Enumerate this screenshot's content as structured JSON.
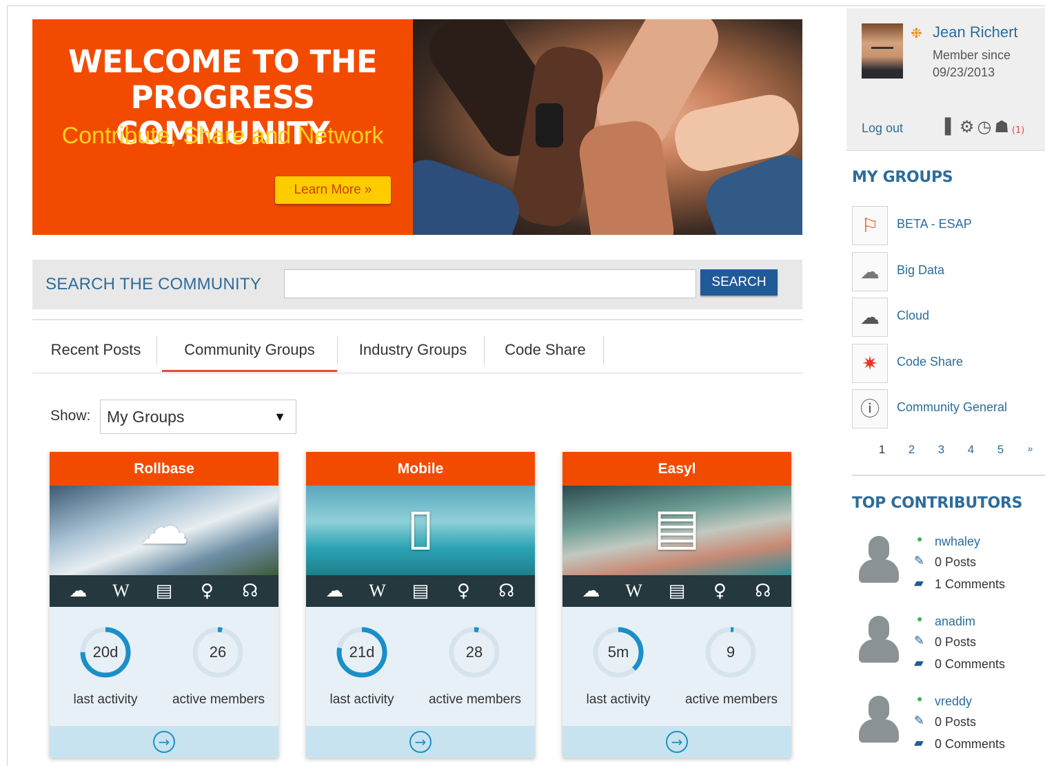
{
  "banner": {
    "title_line1": "WELCOME TO THE",
    "title_line2": "PROGRESS COMMUNITY",
    "subtitle": "Contribute, Share and Network",
    "learn_more": "Learn More »"
  },
  "search": {
    "label": "SEARCH THE COMMUNITY",
    "value": "",
    "button": "SEARCH"
  },
  "tabs": [
    {
      "label": "Recent Posts",
      "active": false
    },
    {
      "label": "Community Groups",
      "active": true
    },
    {
      "label": "Industry Groups",
      "active": false
    },
    {
      "label": "Code Share",
      "active": false
    }
  ],
  "filter": {
    "label": "Show:",
    "selected": "My Groups",
    "arrow": "▼"
  },
  "cards": [
    {
      "title": "Rollbase",
      "icon": "cloud-table-icon",
      "last_activity": "20d",
      "last_activity_label": "last activity",
      "active_members": "26",
      "active_members_label": "active members",
      "activity_fill": 0.75,
      "members_fill": 0.03
    },
    {
      "title": "Mobile",
      "icon": "smartphone-icon",
      "last_activity": "21d",
      "last_activity_label": "last activity",
      "active_members": "28",
      "active_members_label": "active members",
      "activity_fill": 0.78,
      "members_fill": 0.03
    },
    {
      "title": "Easyl",
      "icon": "report-document-icon",
      "last_activity": "5m",
      "last_activity_label": "last activity",
      "active_members": "9",
      "active_members_label": "active members",
      "activity_fill": 0.38,
      "members_fill": 0.01
    }
  ],
  "card_toolbar_icons": [
    "discussions-icon",
    "wiki-icon",
    "documents-icon",
    "ideas-icon",
    "rss-feed-icon"
  ],
  "profile": {
    "name": "Jean Richert",
    "member_since_line1": "Member since",
    "member_since_line2": "09/23/2013",
    "logout": "Log out",
    "notification_count": "(1)"
  },
  "my_groups": {
    "heading": "MY GROUPS",
    "items": [
      {
        "name": "BETA - ESAP",
        "icon": "beta-person-icon"
      },
      {
        "name": "Big Data",
        "icon": "cloud-outline-icon"
      },
      {
        "name": "Cloud",
        "icon": "cloud-filled-icon"
      },
      {
        "name": "Code Share",
        "icon": "starburst-icon"
      },
      {
        "name": "Community General",
        "icon": "people-info-icon"
      }
    ],
    "pages": [
      "1",
      "2",
      "3",
      "4",
      "5",
      "»"
    ]
  },
  "top_contributors": {
    "heading": "TOP CONTRIBUTORS",
    "items": [
      {
        "name": "nwhaley",
        "posts": "0 Posts",
        "comments": "1 Comments"
      },
      {
        "name": "anadim",
        "posts": "0 Posts",
        "comments": "0 Comments"
      },
      {
        "name": "vreddy",
        "posts": "0 Posts",
        "comments": "0 Comments"
      }
    ]
  },
  "colors": {
    "accent_orange": "#f24b00",
    "link_blue": "#2d6c9b",
    "button_blue": "#1f5a99",
    "yellow": "#ffcc00",
    "ring_blue": "#1a8fc8"
  }
}
